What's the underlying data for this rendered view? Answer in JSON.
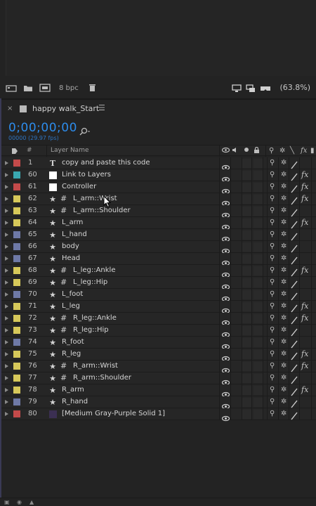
{
  "project_panel": {
    "bit_depth": "8 bpc",
    "zoom": "(63.8%)"
  },
  "timeline": {
    "tab_title": "happy walk_Start",
    "timecode": "0;00;00;00",
    "fps_text": "00000 (29.97 fps)",
    "column_hash": "#",
    "column_layer_name": "Layer Name"
  },
  "colors": {
    "label_red": "#c34a4a",
    "label_cyan": "#3aa7b0",
    "label_yellow": "#d6c85a",
    "label_blue_gray": "#6e79a6",
    "label_white": "#ffffff",
    "timecode_blue": "#2d8ceb"
  },
  "layers": [
    {
      "num": "1",
      "name": "copy and paste this code",
      "label": "red",
      "type": "text",
      "grid": false,
      "fx": false,
      "swatch": false
    },
    {
      "num": "60",
      "name": "Link to Layers",
      "label": "cyan",
      "type": "solid",
      "grid": false,
      "fx": true,
      "swatch": "white"
    },
    {
      "num": "61",
      "name": "Controller",
      "label": "red",
      "type": "solid",
      "grid": false,
      "fx": true,
      "swatch": "white"
    },
    {
      "num": "62",
      "name": "L_arm::Wrist",
      "label": "yellow",
      "type": "star",
      "grid": true,
      "fx": true,
      "swatch": false
    },
    {
      "num": "63",
      "name": "L_arm::Shoulder",
      "label": "yellow",
      "type": "star",
      "grid": true,
      "fx": false,
      "swatch": false
    },
    {
      "num": "64",
      "name": "L_arm",
      "label": "yellow",
      "type": "star",
      "grid": false,
      "fx": true,
      "swatch": false
    },
    {
      "num": "65",
      "name": "L_hand",
      "label": "blue_gray",
      "type": "star",
      "grid": false,
      "fx": false,
      "swatch": false
    },
    {
      "num": "66",
      "name": "body",
      "label": "blue_gray",
      "type": "star",
      "grid": false,
      "fx": false,
      "swatch": false
    },
    {
      "num": "67",
      "name": "Head",
      "label": "blue_gray",
      "type": "star",
      "grid": false,
      "fx": false,
      "swatch": false
    },
    {
      "num": "68",
      "name": "L_leg::Ankle",
      "label": "yellow",
      "type": "star",
      "grid": true,
      "fx": true,
      "swatch": false
    },
    {
      "num": "69",
      "name": "L_leg::Hip",
      "label": "yellow",
      "type": "star",
      "grid": true,
      "fx": false,
      "swatch": false
    },
    {
      "num": "70",
      "name": "L_foot",
      "label": "blue_gray",
      "type": "star",
      "grid": false,
      "fx": false,
      "swatch": false
    },
    {
      "num": "71",
      "name": "L_leg",
      "label": "yellow",
      "type": "star",
      "grid": false,
      "fx": true,
      "swatch": false
    },
    {
      "num": "72",
      "name": "R_leg::Ankle",
      "label": "yellow",
      "type": "star",
      "grid": true,
      "fx": true,
      "swatch": false
    },
    {
      "num": "73",
      "name": "R_leg::Hip",
      "label": "yellow",
      "type": "star",
      "grid": true,
      "fx": false,
      "swatch": false
    },
    {
      "num": "74",
      "name": "R_foot",
      "label": "blue_gray",
      "type": "star",
      "grid": false,
      "fx": false,
      "swatch": false
    },
    {
      "num": "75",
      "name": "R_leg",
      "label": "yellow",
      "type": "star",
      "grid": false,
      "fx": true,
      "swatch": false
    },
    {
      "num": "76",
      "name": "R_arm::Wrist",
      "label": "yellow",
      "type": "star",
      "grid": true,
      "fx": true,
      "swatch": false
    },
    {
      "num": "77",
      "name": "R_arm::Shoulder",
      "label": "yellow",
      "type": "star",
      "grid": true,
      "fx": false,
      "swatch": false
    },
    {
      "num": "78",
      "name": "R_arm",
      "label": "yellow",
      "type": "star",
      "grid": false,
      "fx": true,
      "swatch": false
    },
    {
      "num": "79",
      "name": "R_hand",
      "label": "blue_gray",
      "type": "star",
      "grid": false,
      "fx": false,
      "swatch": false
    },
    {
      "num": "80",
      "name": "[Medium Gray-Purple Solid 1]",
      "label": "red",
      "type": "solid",
      "grid": false,
      "fx": false,
      "swatch": "purple"
    }
  ]
}
